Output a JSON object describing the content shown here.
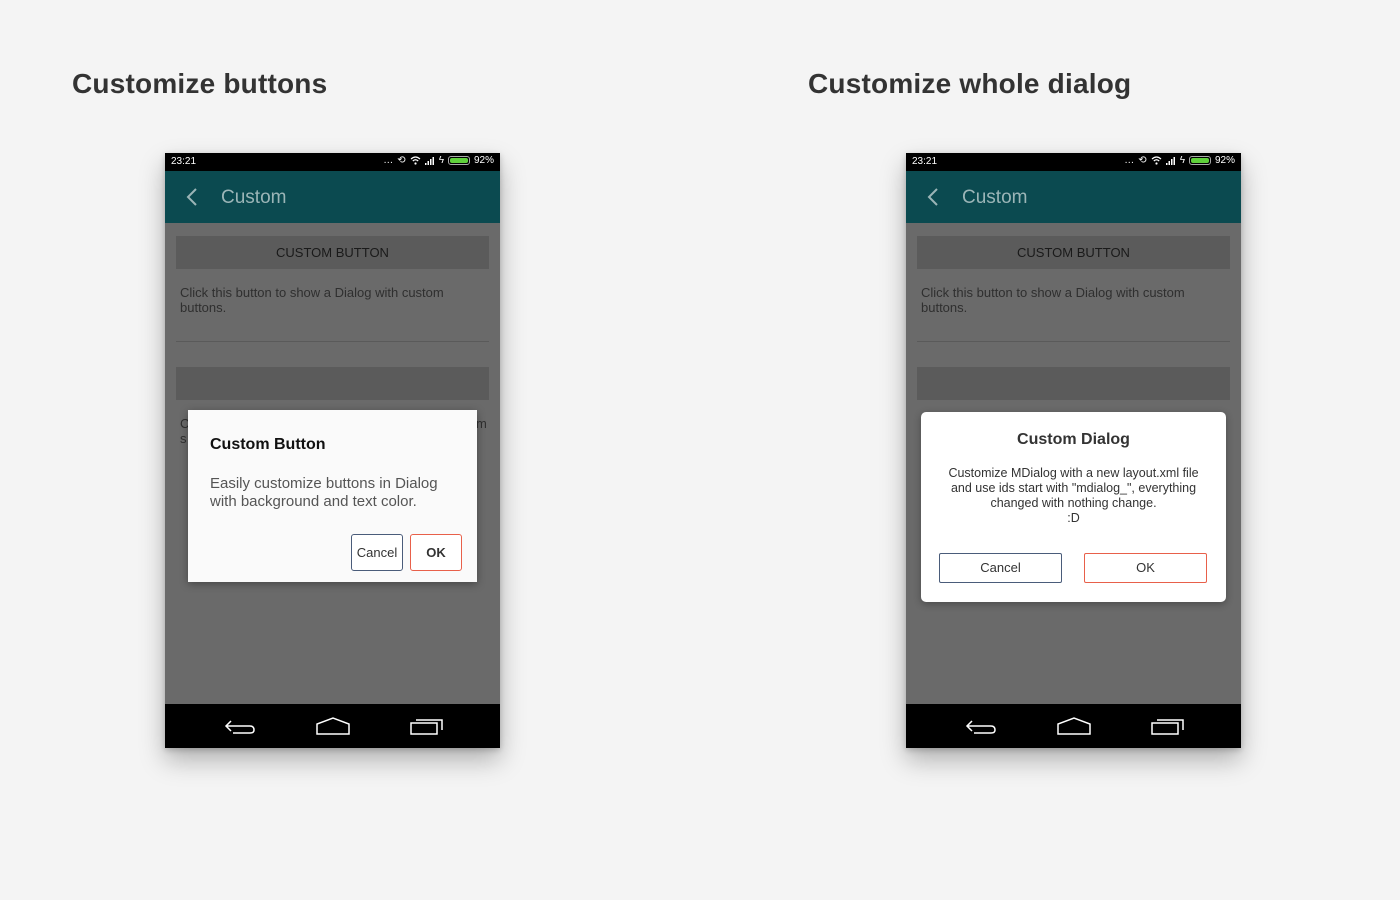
{
  "sections": [
    {
      "title": "Customize buttons",
      "phone": {
        "status": {
          "time": "23:21",
          "battery_pct": "92%",
          "icons": [
            "more-icon",
            "sync-icon",
            "wifi-icon",
            "signal-icon",
            "charging-icon",
            "battery-icon"
          ]
        },
        "app_bar": {
          "title": "Custom",
          "back_icon": "chevron-left-icon"
        },
        "content": {
          "button_label": "CUSTOM BUTTON",
          "description": "Click this button to show a Dialog with custom buttons.",
          "partial_left_1": "C",
          "partial_left_2": "s",
          "partial_right": "m"
        },
        "dialog": {
          "title": "Custom Button",
          "body": "Easily customize buttons in Dialog with background and text color.",
          "cancel_label": "Cancel",
          "ok_label": "OK"
        },
        "nav": [
          "back-icon",
          "home-icon",
          "recents-icon"
        ]
      }
    },
    {
      "title": "Customize whole dialog",
      "phone": {
        "status": {
          "time": "23:21",
          "battery_pct": "92%",
          "icons": [
            "more-icon",
            "sync-icon",
            "wifi-icon",
            "signal-icon",
            "charging-icon",
            "battery-icon"
          ]
        },
        "app_bar": {
          "title": "Custom",
          "back_icon": "chevron-left-icon"
        },
        "content": {
          "button_label": "CUSTOM BUTTON",
          "description": "Click this button to show a Dialog with custom buttons."
        },
        "dialog": {
          "title": "Custom Dialog",
          "body_line1": "Customize MDialog with a new layout.xml file",
          "body_line2": "and use ids start with \"mdialog_\", everything",
          "body_line3": "changed with nothing change.",
          "body_line4": ":D",
          "cancel_label": "Cancel",
          "ok_label": "OK"
        },
        "nav": [
          "back-icon",
          "home-icon",
          "recents-icon"
        ]
      }
    }
  ],
  "colors": {
    "page_bg": "#f4f4f4",
    "app_bar": "#0b4a50",
    "app_title": "#9bb5b7",
    "cancel_border": "#4a5c7a",
    "ok_border": "#e8604a",
    "battery": "#5fd13b"
  }
}
